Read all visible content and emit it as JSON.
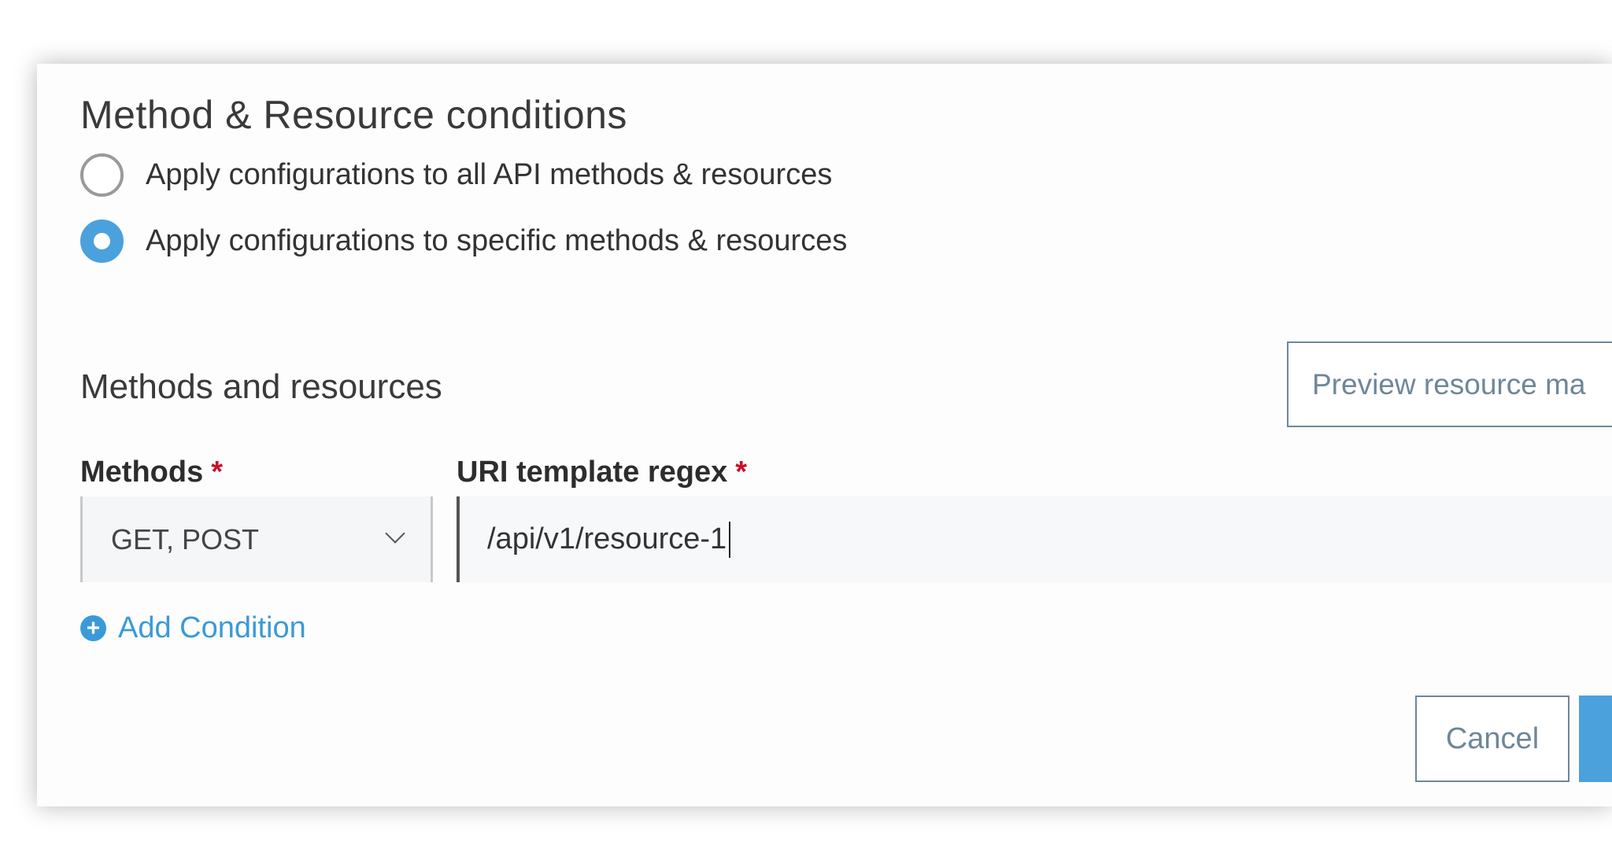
{
  "section_title": "Method & Resource conditions",
  "radio_options": [
    {
      "label": "Apply configurations to all API methods & resources",
      "selected": false
    },
    {
      "label": "Apply configurations to specific methods & resources",
      "selected": true
    }
  ],
  "subsection_title": "Methods and resources",
  "preview_button_label": "Preview resource ma",
  "methods": {
    "label": "Methods",
    "required_mark": "*",
    "value": "GET, POST"
  },
  "uri": {
    "label": "URI template regex",
    "required_mark": "*",
    "value": "/api/v1/resource-1"
  },
  "add_condition_label": "Add Condition",
  "add_condition_icon": "+",
  "cancel_label": "Cancel",
  "colors": {
    "accent": "#4aa1dc",
    "required": "#c8102e",
    "secondary": "#6e8798"
  }
}
